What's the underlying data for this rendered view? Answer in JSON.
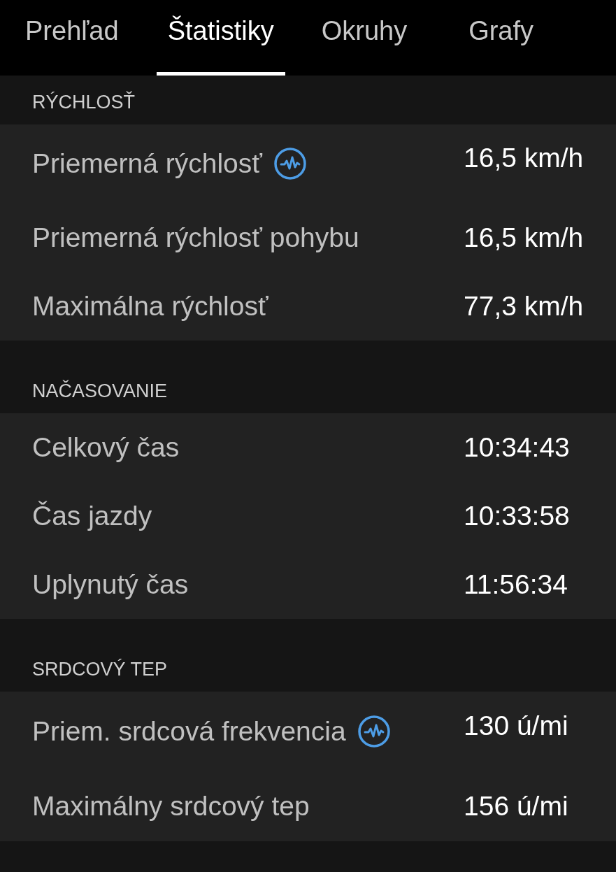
{
  "tabs": [
    {
      "label": "Prehľad",
      "selected": false
    },
    {
      "label": "Štatistiky",
      "selected": true
    },
    {
      "label": "Okruhy",
      "selected": false
    },
    {
      "label": "Grafy",
      "selected": false
    }
  ],
  "sections": [
    {
      "title": "RÝCHLOSŤ",
      "rows": [
        {
          "label": "Priemerná rýchlosť",
          "value": "16,5 km/h",
          "kind": "sensor"
        },
        {
          "label": "Priemerná rýchlosť pohybu",
          "value": "16,5 km/h",
          "kind": "plain"
        },
        {
          "label": "Maximálna rýchlosť",
          "value": "77,3 km/h",
          "kind": "plain"
        }
      ]
    },
    {
      "title": "NAČASOVANIE",
      "rows": [
        {
          "label": "Celkový čas",
          "value": "10:34:43",
          "kind": "plain"
        },
        {
          "label": "Čas jazdy",
          "value": "10:33:58",
          "kind": "plain"
        },
        {
          "label": "Uplynutý čas",
          "value": "11:56:34",
          "kind": "plain"
        }
      ]
    },
    {
      "title": "SRDCOVÝ TEP",
      "rows": [
        {
          "label": "Priem. srdcová frekvencia",
          "value": "130 ú/mi",
          "kind": "sensor"
        },
        {
          "label": "Maximálny srdcový tep",
          "value": "156 ú/mi",
          "kind": "plain"
        }
      ]
    }
  ]
}
